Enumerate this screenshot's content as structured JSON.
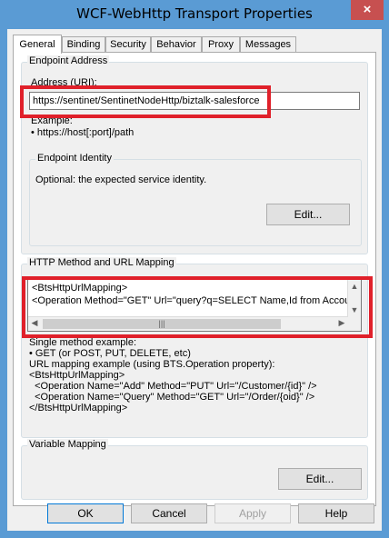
{
  "window": {
    "title": "WCF-WebHttp Transport Properties",
    "close_glyph": "×"
  },
  "tabs": [
    {
      "label": "General",
      "active": true
    },
    {
      "label": "Binding",
      "active": false
    },
    {
      "label": "Security",
      "active": false
    },
    {
      "label": "Behavior",
      "active": false
    },
    {
      "label": "Proxy",
      "active": false
    },
    {
      "label": "Messages",
      "active": false
    }
  ],
  "endpoint_address": {
    "group_label": "Endpoint Address",
    "address_label": "Address (URI):",
    "address_value": "https://sentinet/SentinetNodeHttp/biztalk-salesforce",
    "example_label": "Example:",
    "example_value": "• https://host[:port]/path"
  },
  "endpoint_identity": {
    "group_label": "Endpoint Identity",
    "description": "Optional: the expected service identity.",
    "edit_label": "Edit..."
  },
  "http_mapping": {
    "group_label": "HTTP Method and URL Mapping",
    "lines": [
      "<BtsHttpUrlMapping>",
      "  <Operation Method=\"GET\" Url=\"query?q=SELECT Name,Id from Account"
    ],
    "help_lines": [
      "Single method example:",
      "• GET (or POST, PUT, DELETE, etc)",
      "URL mapping example (using BTS.Operation property):",
      "<BtsHttpUrlMapping>",
      "  <Operation Name=\"Add\" Method=\"PUT\" Url=\"/Customer/{id}\" />",
      "  <Operation Name=\"Query\" Method=\"GET\" Url=\"/Order/{oid}\" />",
      "</BtsHttpUrlMapping>"
    ]
  },
  "variable_mapping": {
    "group_label": "Variable Mapping",
    "edit_label": "Edit..."
  },
  "footer": {
    "ok_label": "OK",
    "cancel_label": "Cancel",
    "apply_label": "Apply",
    "help_label": "Help"
  },
  "colors": {
    "highlight": "#e0202a",
    "titlebar": "#5a9bd4",
    "close": "#c75050"
  }
}
